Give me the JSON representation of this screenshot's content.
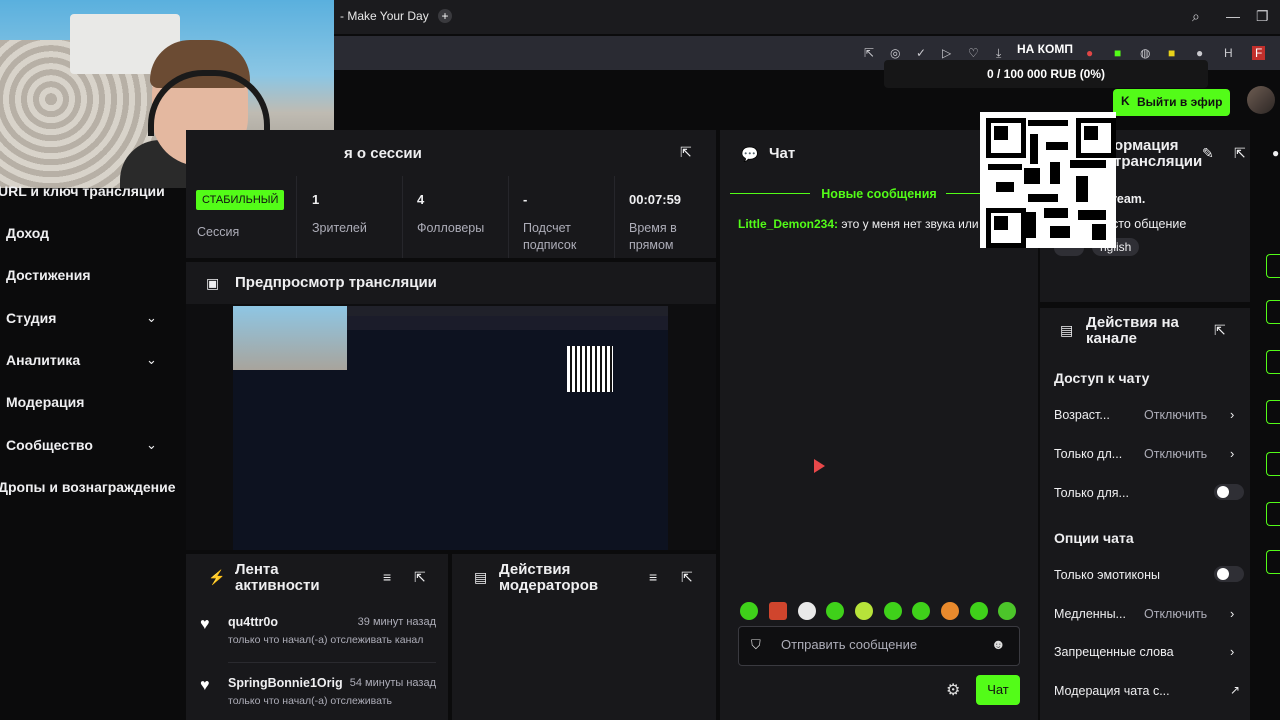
{
  "browser": {
    "tab_title": "- Make Your Day",
    "extension_label": "НА КОМП"
  },
  "goal": {
    "text": "0 / 100 000 RUB (0%)"
  },
  "header": {
    "go_live": "Выйти в эфир"
  },
  "nav": {
    "items": [
      {
        "label": "URL и ключ трансляции"
      },
      {
        "label": "Доход"
      },
      {
        "label": "Достижения"
      },
      {
        "label": "Студия"
      },
      {
        "label": "Аналитика"
      },
      {
        "label": "Модерация"
      },
      {
        "label": "Сообщество"
      },
      {
        "label": "Дропы и вознаграждение"
      }
    ]
  },
  "session": {
    "title": "я о сессии",
    "status_badge": "СТАБИЛЬНЫЙ",
    "status_label": "Сессия",
    "stats": [
      {
        "value": "1",
        "label": "Зрителей"
      },
      {
        "value": "4",
        "label": "Фолловеры"
      },
      {
        "value": "-",
        "label": "Подсчет подписок"
      },
      {
        "value": "00:07:59",
        "label": "Время в прямом"
      }
    ]
  },
  "preview": {
    "title": "Предпросмотр трансляции"
  },
  "activity": {
    "title": "Лента активности",
    "items": [
      {
        "user": "qu4ttr0o",
        "time": "39 минут назад",
        "desc": "только что начал(-а) отслеживать канал"
      },
      {
        "user": "SpringBonnie1Orig",
        "time": "54 минуты назад",
        "desc": "только что начал(-а) отслеживать"
      }
    ]
  },
  "moderators": {
    "title": "Действия модераторов"
  },
  "chat": {
    "title": "Чат",
    "new_messages": "Новые сообщения",
    "message_user": "Little_Demon234:",
    "message_text": " это у меня нет звука или как",
    "placeholder": "Отправить сообщение",
    "send_label": "Чат"
  },
  "info": {
    "title": "ормация трансляции",
    "line1": "ream.",
    "line2": "сто общение",
    "tag": "nglish"
  },
  "channel_actions": {
    "title": "Действия на канале",
    "chat_access": "Доступ к чату",
    "rows1": [
      {
        "label": "Возраст...",
        "value": "Отключить"
      },
      {
        "label": "Только дл...",
        "value": "Отключить"
      },
      {
        "label": "Только для..."
      }
    ],
    "chat_options": "Опции чата",
    "rows2": [
      {
        "label": "Только эмотиконы"
      },
      {
        "label": "Медленны...",
        "value": "Отключить"
      },
      {
        "label": "Запрещенные слова"
      },
      {
        "label": "Модерация чата с..."
      }
    ]
  }
}
